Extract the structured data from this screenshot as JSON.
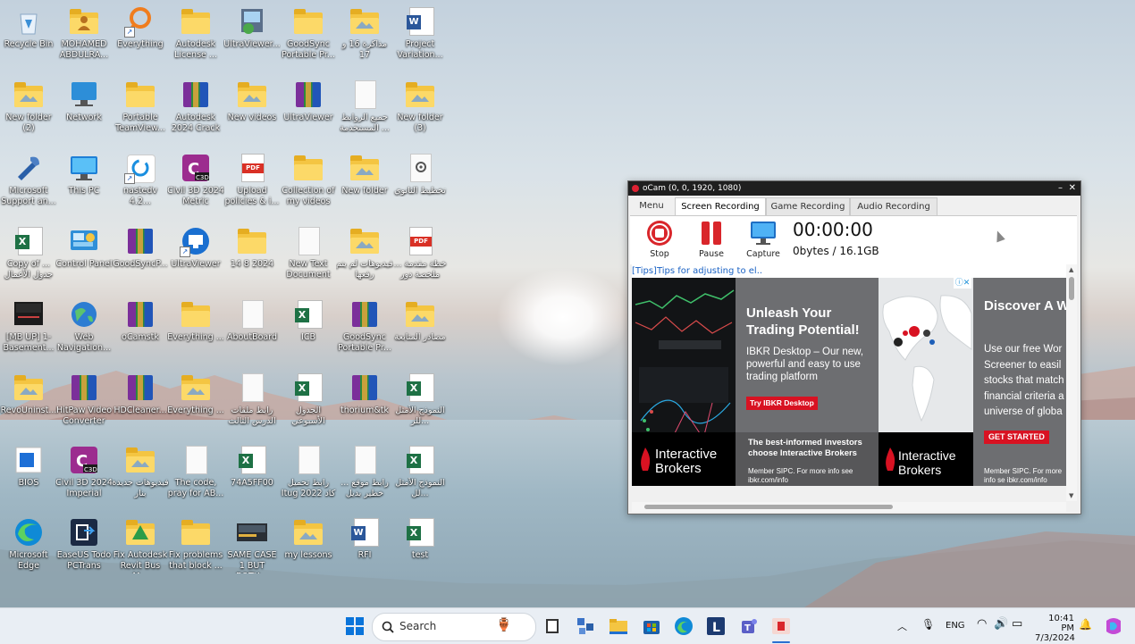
{
  "desktop": {
    "icons": [
      {
        "label": "Recycle Bin",
        "kind": "recycle"
      },
      {
        "label": "MOHAMED ABDULRA...",
        "kind": "user"
      },
      {
        "label": "Everything",
        "kind": "everything",
        "shortcut": true
      },
      {
        "label": "Autodesk License ...",
        "kind": "folder"
      },
      {
        "label": "UltraViewer...",
        "kind": "installer"
      },
      {
        "label": "GoodSync Portable Pr...",
        "kind": "folder"
      },
      {
        "label": "مذاكرة 16 و 17",
        "kind": "folder-photo"
      },
      {
        "label": "Project Variation...",
        "kind": "word"
      },
      {
        "label": "New folder (2)",
        "kind": "folder-photo"
      },
      {
        "label": "Network",
        "kind": "network"
      },
      {
        "label": "Portable TeamView...",
        "kind": "folder"
      },
      {
        "label": "Autodesk 2024 Crack",
        "kind": "rar"
      },
      {
        "label": "New videos",
        "kind": "folder-photo"
      },
      {
        "label": "UltraViewer",
        "kind": "rar"
      },
      {
        "label": "جميع الروابط المستخدمة ...",
        "kind": "doc"
      },
      {
        "label": "New folder (3)",
        "kind": "folder-photo"
      },
      {
        "label": "Microsoft Support an...",
        "kind": "tools"
      },
      {
        "label": "This PC",
        "kind": "pc"
      },
      {
        "label": "nastedv 4.2...",
        "kind": "nastedv",
        "shortcut": true
      },
      {
        "label": "Civil 3D 2024 Metric",
        "kind": "civil"
      },
      {
        "label": "Upload policies & i...",
        "kind": "pdf"
      },
      {
        "label": "Collection of my videos",
        "kind": "folder"
      },
      {
        "label": "New folder",
        "kind": "folder-photo"
      },
      {
        "label": "تخطيط الثانوي",
        "kind": "settings-doc"
      },
      {
        "label": "Copy of ... جدول الأعمال",
        "kind": "excel"
      },
      {
        "label": "Control Panel",
        "kind": "control"
      },
      {
        "label": "GoodSyncP...",
        "kind": "rar"
      },
      {
        "label": "UltraViewer",
        "kind": "ultraviewer",
        "shortcut": true
      },
      {
        "label": "14 8 2024",
        "kind": "folder"
      },
      {
        "label": "New Text Document",
        "kind": "doc"
      },
      {
        "label": "فيديوهات لم يتم رفعها",
        "kind": "folder-photo"
      },
      {
        "label": "خطة مقدمة ... ملخصة دور",
        "kind": "pdf"
      },
      {
        "label": "[MB UP] 1-Basement...",
        "kind": "screen"
      },
      {
        "label": "Web Navigation...",
        "kind": "globe"
      },
      {
        "label": "oCamstk",
        "kind": "rar"
      },
      {
        "label": "Everything ...",
        "kind": "folder"
      },
      {
        "label": "AboutBoard",
        "kind": "doc"
      },
      {
        "label": "ICB",
        "kind": "excel"
      },
      {
        "label": "GoodSync Portable Pr...",
        "kind": "rar"
      },
      {
        "label": "مصادر المتابعة",
        "kind": "folder-photo"
      },
      {
        "label": "RevoUninst...",
        "kind": "folder-photo"
      },
      {
        "label": "HitPaw Video Converter",
        "kind": "rar"
      },
      {
        "label": "HDCleaner...",
        "kind": "rar"
      },
      {
        "label": "Everything ...",
        "kind": "folder-photo"
      },
      {
        "label": "رابط ملفات الدرس الثالث",
        "kind": "doc"
      },
      {
        "label": "الجدول الأسبوعي",
        "kind": "excel"
      },
      {
        "label": "thorium&tk",
        "kind": "rar"
      },
      {
        "label": "النموذج الأمثل للر...",
        "kind": "excel"
      },
      {
        "label": "BIOS",
        "kind": "bios"
      },
      {
        "label": "Civil 3D 2024 Imperial",
        "kind": "civil"
      },
      {
        "label": "فيديوهات جديدة بنار",
        "kind": "folder-photo"
      },
      {
        "label": "The code, pray for AB...",
        "kind": "doc"
      },
      {
        "label": "74A5FF00",
        "kind": "excel"
      },
      {
        "label": "رابط تحميل Itug 2022 كاد",
        "kind": "doc"
      },
      {
        "label": "رابط موقع ... خطير بديل",
        "kind": "doc"
      },
      {
        "label": "النموذج الأمثل لل...",
        "kind": "excel"
      },
      {
        "label": "Microsoft Edge",
        "kind": "edge"
      },
      {
        "label": "EaseUS Todo PCTrans",
        "kind": "easeus"
      },
      {
        "label": "Fix Autodesk Revit Bus M...",
        "kind": "folder-green"
      },
      {
        "label": "Fix problems that block ...",
        "kind": "folder"
      },
      {
        "label": "SAME CASE 1 BUT BOTH...",
        "kind": "video"
      },
      {
        "label": "my lessons",
        "kind": "folder-photo"
      },
      {
        "label": "RFI",
        "kind": "word"
      },
      {
        "label": "test",
        "kind": "excel"
      }
    ]
  },
  "ocam": {
    "title": "oCam (0, 0, 1920, 1080)",
    "tabs": [
      "Menu",
      "Screen Recording",
      "Game Recording",
      "Audio Recording"
    ],
    "active_tab": "Screen Recording",
    "buttons": {
      "stop": "Stop",
      "pause": "Pause",
      "capture": "Capture"
    },
    "timer": "00:00:00",
    "size": "0bytes / 16.1GB",
    "tips": "[Tips]Tips for adjusting to el..",
    "ad": {
      "headline1": "Unleash Your Trading Potential!",
      "body1": "IBKR Desktop – Our new, powerful and easy to use trading platform",
      "cta1": "Try IBKR Desktop",
      "brand": "Interactive Brokers",
      "tagline": "The best-informed investors choose Interactive Brokers",
      "member": "Member SIPC. For more info see ibkr.com/info",
      "headline2": "Discover A W of Opportuni",
      "body2": "Use our free Wor Screener to easil stocks that match financial criteria a universe of globa",
      "cta2": "GET STARTED",
      "member2": "Member SIPC. For more info se ibkr.com/info"
    }
  },
  "taskbar": {
    "search_label": "Search",
    "language": "ENG",
    "time": "10:41 PM",
    "date": "7/3/2024"
  },
  "colors": {
    "taskbar_bg": "#e9eef4",
    "ocam_accent": "#d9262b",
    "ibkr_red": "#d81222",
    "ad_gray": "#6d6e71"
  }
}
